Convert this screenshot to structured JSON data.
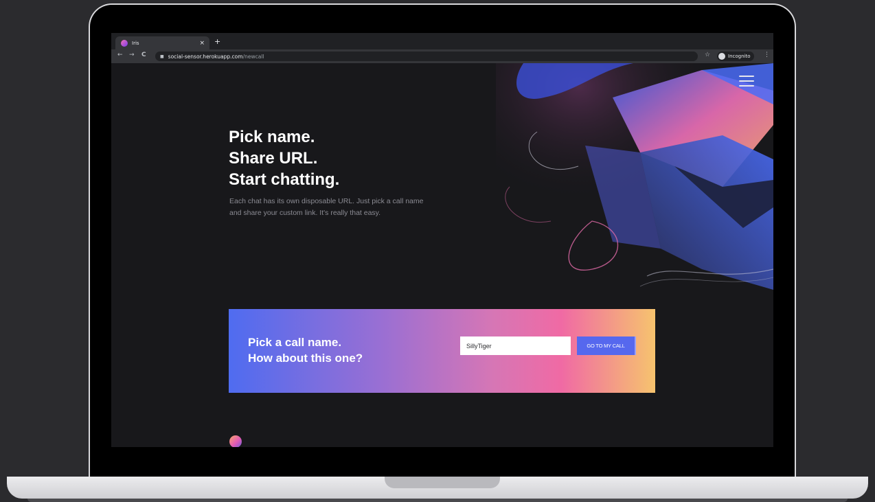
{
  "browser": {
    "tab_title": "Iris",
    "tab_close": "×",
    "new_tab": "+",
    "nav_back": "←",
    "nav_forward": "→",
    "nav_reload": "C",
    "url_host": "social-sensor.herokuapp.com",
    "url_path": "/newcall",
    "bookmark_star": "☆",
    "profile_label": "Incognito",
    "menu_glyph": "⋮"
  },
  "hero": {
    "headline_lines": [
      "Pick name.",
      "Share URL.",
      "Start chatting."
    ],
    "description": "Each chat has its own disposable URL. Just pick a call name and share your custom link. It's really that easy."
  },
  "cta": {
    "title_lines": [
      "Pick a call name.",
      "How about this one?"
    ],
    "input_value": "SillyTiger",
    "button_label": "GO TO MY CALL"
  },
  "colors": {
    "page_bg": "#18181b",
    "gradient_start": "#4f6cf0",
    "gradient_mid": "#f06aa4",
    "gradient_end": "#f6c36e",
    "button_bg": "#5668ee"
  },
  "icons": [
    "lock-icon",
    "star-icon",
    "incognito-icon",
    "hamburger-menu-icon",
    "close-icon"
  ]
}
